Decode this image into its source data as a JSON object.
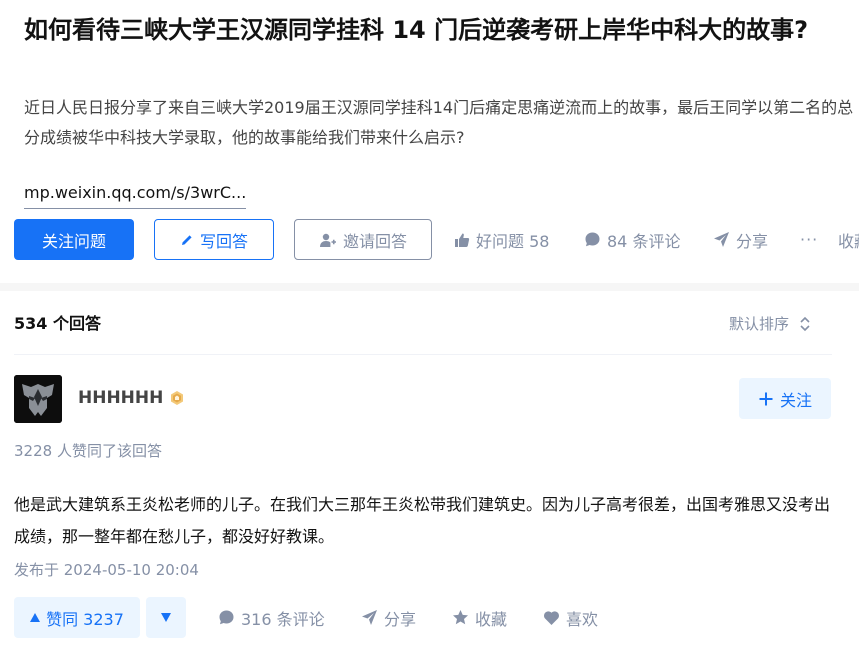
{
  "question": {
    "title": "如何看待三峡大学王汉源同学挂科 14 门后逆袭考研上岸华中科大的故事?",
    "description": "近日人民日报分享了来自三峡大学2019届王汉源同学挂科14门后痛定思痛逆流而上的故事，最后王同学以第二名的总分成绩被华中科技大学录取，他的故事能给我们带来什么启示?",
    "link_text": "mp.weixin.qq.com/s/3wrC...",
    "actions": {
      "follow_label": "关注问题",
      "write_label": "写回答",
      "invite_label": "邀请回答",
      "good_question": "好问题 58",
      "comments": "84 条评论",
      "share": "分享",
      "more": "···",
      "collect": "收藏"
    }
  },
  "answers_header": {
    "count_label": "534 个回答",
    "sort_label": "默认排序"
  },
  "answer": {
    "author_name": "HHHHHH",
    "follow_label": "关注",
    "upvote_note": "3228 人赞同了该回答",
    "content": "他是武大建筑系王炎松老师的儿子。在我们大三那年王炎松带我们建筑史。因为儿子高考很差，出国考雅思又没考出成绩，那一整年都在愁儿子，都没好好教课。",
    "published": "发布于 2024-05-10 20:04",
    "actions": {
      "upvote_label": "赞同 3237",
      "comments": "316 条评论",
      "share": "分享",
      "collect": "收藏",
      "like": "喜欢"
    }
  },
  "colors": {
    "brand_blue": "#1772f6",
    "light_blue_bg": "#ebf5ff",
    "meta_gray": "#8590a6",
    "badge_gold": "#e5a94a"
  }
}
